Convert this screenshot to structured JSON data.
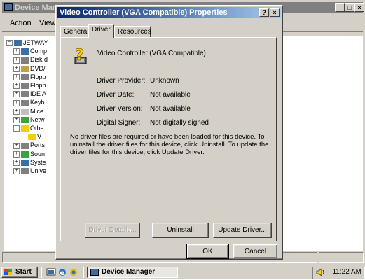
{
  "device_manager": {
    "title": "Device Man",
    "menu": {
      "action": "Action",
      "view": "View"
    },
    "tree": [
      {
        "label": "JETWAY-",
        "sign": "−",
        "indent": 0
      },
      {
        "label": "Comp",
        "sign": "+",
        "indent": 1
      },
      {
        "label": "Disk d",
        "sign": "+",
        "indent": 1
      },
      {
        "label": "DVD/",
        "sign": "+",
        "indent": 1
      },
      {
        "label": "Flopp",
        "sign": "+",
        "indent": 1
      },
      {
        "label": "Flopp",
        "sign": "+",
        "indent": 1
      },
      {
        "label": "IDE A",
        "sign": "+",
        "indent": 1
      },
      {
        "label": "Keyb",
        "sign": "+",
        "indent": 1
      },
      {
        "label": "Mice",
        "sign": "+",
        "indent": 1
      },
      {
        "label": "Netw",
        "sign": "+",
        "indent": 1
      },
      {
        "label": "Othe",
        "sign": "−",
        "indent": 1
      },
      {
        "label": "V",
        "sign": "",
        "indent": 2
      },
      {
        "label": "Ports",
        "sign": "+",
        "indent": 1
      },
      {
        "label": "Soun",
        "sign": "+",
        "indent": 1
      },
      {
        "label": "Syste",
        "sign": "+",
        "indent": 1
      },
      {
        "label": "Unive",
        "sign": "+",
        "indent": 1
      }
    ],
    "caption_buttons": [
      "_",
      "□",
      "×"
    ]
  },
  "dialog": {
    "title": "Video Controller (VGA Compatible) Properties",
    "help_button": "?",
    "close_button": "×",
    "tabs": [
      "General",
      "Driver",
      "Resources"
    ],
    "active_tab": "Driver",
    "device_name": "Video Controller (VGA Compatible)",
    "properties": [
      {
        "label": "Driver Provider:",
        "value": "Unknown"
      },
      {
        "label": "Driver Date:",
        "value": "Not available"
      },
      {
        "label": "Driver Version:",
        "value": "Not available"
      },
      {
        "label": "Digital Signer:",
        "value": "Not digitally signed"
      }
    ],
    "description": "No driver files are required or have been loaded for this device. To uninstall the driver files for this device, click Uninstall. To update the driver files for this device, click Update Driver.",
    "buttons": {
      "driver_details": "Driver Details...",
      "uninstall": "Uninstall",
      "update_driver": "Update Driver...",
      "ok": "OK",
      "cancel": "Cancel"
    }
  },
  "taskbar": {
    "start": "Start",
    "item": "Device Manager",
    "clock": "11:22 AM"
  },
  "colors": {
    "face": "#d4d0c8",
    "title_active": "#0a246a",
    "title_inactive": "#808080"
  }
}
